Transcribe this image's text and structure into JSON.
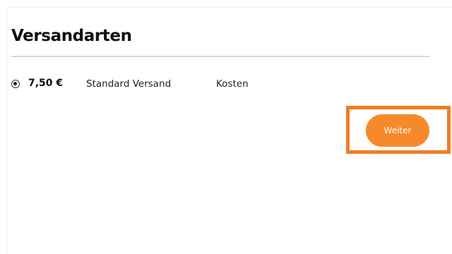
{
  "section": {
    "title": "Versandarten"
  },
  "shipping_options": [
    {
      "selected": true,
      "price": "7,50 €",
      "name": "Standard Versand",
      "costs_label": "Kosten"
    }
  ],
  "actions": {
    "continue_label": "Weiter"
  },
  "colors": {
    "accent": "#f68a2a",
    "highlight_border": "#f07d25",
    "divider": "#d8d8de"
  }
}
